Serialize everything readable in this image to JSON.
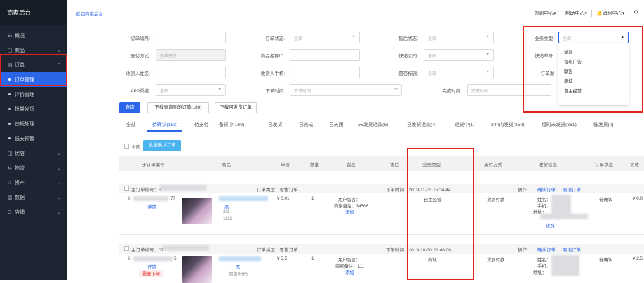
{
  "sidebar": {
    "title": "商家后台",
    "items": [
      {
        "icon": "☷",
        "label": "概况"
      },
      {
        "icon": "▢",
        "label": "商品"
      },
      {
        "icon": "▤",
        "label": "订单"
      },
      {
        "label": "订单管理"
      },
      {
        "label": "评价管理"
      },
      {
        "label": "批量发货"
      },
      {
        "label": "违规处理"
      },
      {
        "label": "低安预警"
      },
      {
        "icon": "◫",
        "label": "优店"
      },
      {
        "icon": "⇆",
        "label": "物流"
      },
      {
        "icon": "⌂",
        "label": "资产"
      },
      {
        "icon": "▥",
        "label": "数据"
      },
      {
        "icon": "⊟",
        "label": "店铺"
      }
    ]
  },
  "topbar": {
    "back": "返回商家后台",
    "rules": "规则中心",
    "help": "帮助中心",
    "messages": "消息中心",
    "chevron": "▾"
  },
  "filters": {
    "order_no": "订单编号:",
    "order_status": "订单状态:",
    "order_status_value": "全部",
    "after_sale": "售后状态:",
    "after_sale_value": "全部",
    "biz_type": "业务类型:",
    "biz_type_value": "全部",
    "pay_method": "支付方式:",
    "pay_method_value": "在线支付",
    "product_id": "商品名称ID:",
    "express": "快递公司:",
    "express_value": "全部",
    "express_no": "快递单号:",
    "receiver_name": "收货人姓名:",
    "receiver_phone": "收货人手机:",
    "flag": "是否标旗:",
    "flag_value": "全部",
    "order_send": "订单发",
    "app_channel": "APP渠道:",
    "app_channel_value": "全部",
    "order_time": "下单时间:",
    "order_time_placeholder": "下单时间",
    "finish_time": "完成时间:",
    "finish_time_placeholder": "完成时间",
    "query_btn": "查询",
    "export_btn": "下载查询到的订单(180)",
    "export2_btn": "下载可发货订单"
  },
  "dropdown": [
    "全部",
    "鲁班广告",
    "联盟",
    "商城",
    "自主经营"
  ],
  "tabs": [
    "全部",
    "待确认(183)",
    "待支付",
    "备货中(169)",
    "已发货",
    "已完成",
    "已关闭",
    "未发货退款(6)",
    "已发货退款(4)",
    "退货中(1)",
    "24h内发货(359)",
    "超时未发货(361)",
    "催发货(0)"
  ],
  "bulk": {
    "select_all": "全选",
    "confirm": "批量确认订单"
  },
  "table_headers": [
    "子订单编号",
    "商品",
    "单价",
    "数量",
    "留言",
    "售后",
    "业务类型",
    "支付方式",
    "收货信息",
    "订单状态",
    "实收"
  ],
  "orders": [
    {
      "head": "主订单编号：8",
      "type": "订单类型：零售订单",
      "time": "下单时间：2019-11-03 15:34:44",
      "ops": "操作",
      "confirm": "确认订单",
      "cancel": "取消订单",
      "sub_id_tail": "77",
      "detail": "详情",
      "spec": "黑",
      "qty_text": "2/2",
      "code": "1111",
      "price": "¥ 0.01",
      "qty": "1",
      "msg1": "用户留言：",
      "msg2": "商家备注：34566",
      "add": "添加",
      "biz": "自主经营",
      "pay": "货到付款",
      "name_lbl": "姓名：",
      "phone_lbl": "手机：",
      "addr_lbl": "地址：",
      "edit": "修改",
      "status": "待确认",
      "paid": "¥ 0.0"
    },
    {
      "head": "主订单编号：07",
      "type": "订单类型：零售订单",
      "time": "下单时间：2019-10-30 21:46:06",
      "ops": "操作",
      "confirm": "确认订单",
      "cancel": "取消订单",
      "sub_id_tail": "5",
      "detail": "详情",
      "tag": "重复下单",
      "spec": "黑",
      "code": "颜色/尺码",
      "price": "¥ 5.5",
      "qty": "1",
      "msg1": "用户留言：",
      "msg2": "商家备注：111",
      "add": "添加",
      "biz": "商城",
      "pay": "货到付款",
      "name_lbl": "姓名：",
      "phone_lbl": "手机：",
      "addr_lbl": "地址：",
      "status": "待确认",
      "paid": "¥ 2.5"
    }
  ]
}
